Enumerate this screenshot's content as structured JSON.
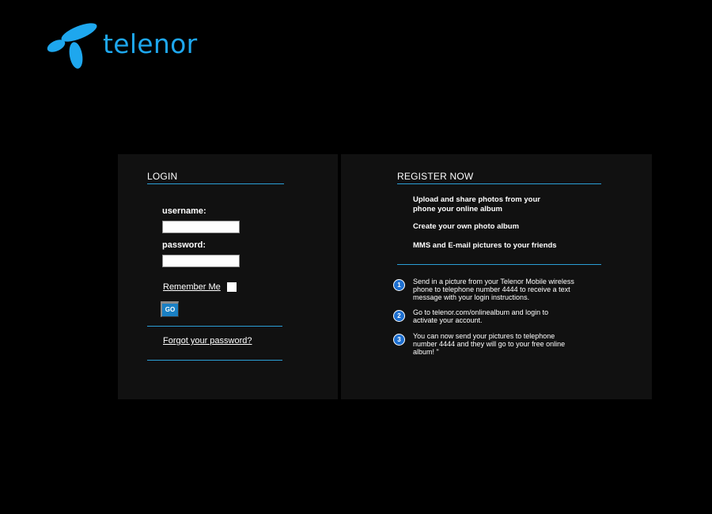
{
  "brand": {
    "name": "telenor",
    "color": "#1ea7ee"
  },
  "login": {
    "heading": "LOGIN",
    "username_label": "username:",
    "username_value": "",
    "password_label": "password:",
    "password_value": "",
    "remember_label": "Remember Me",
    "go_label": "GO",
    "forgot_label": "Forgot your password?"
  },
  "register": {
    "heading": "REGISTER NOW",
    "features": [
      "Upload and share photos from your phone your online album",
      "Create your own photo album",
      "MMS and E-mail pictures to your friends"
    ],
    "steps": [
      {
        "num": "1",
        "text": "Send in a picture from your Telenor Mobile wireless phone to telephone number 4444 to receive a text message with your login instructions."
      },
      {
        "num": "2",
        "text": "Go to telenor.com/onlinealbum and login to activate your account."
      },
      {
        "num": "3",
        "text": "You can now send your pictures to telephone number 4444 and they will go to your free online album! \""
      }
    ]
  },
  "colors": {
    "accent": "#2a9fd6",
    "panel": "#111111",
    "button": "#1a80c4"
  }
}
